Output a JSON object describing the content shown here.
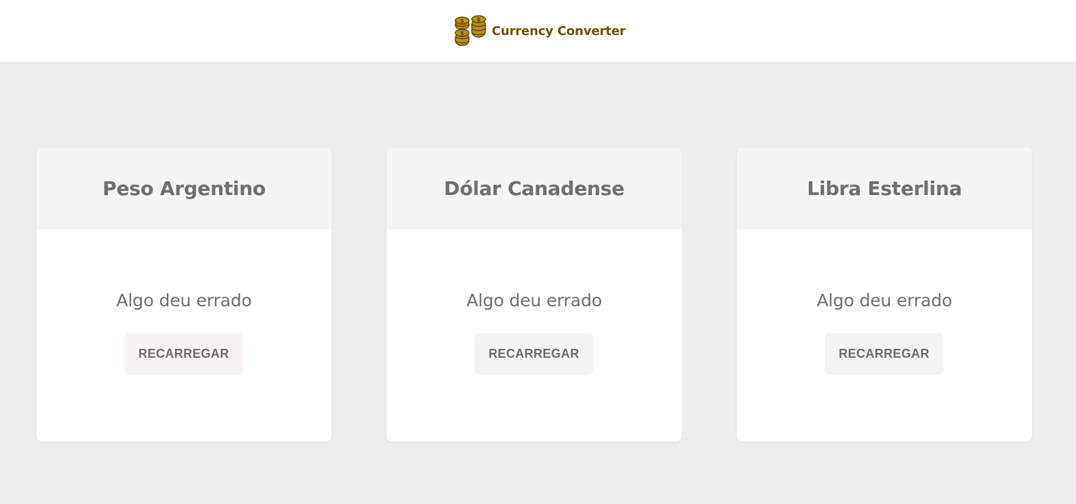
{
  "header": {
    "title": "Currency Converter",
    "logo_icon": "coins-stack-icon",
    "brand_color": "#6b5506"
  },
  "cards": [
    {
      "title": "Peso Argentino",
      "message": "Algo deu errado",
      "button_label": "RECARREGAR"
    },
    {
      "title": "Dólar Canadense",
      "message": "Algo deu errado",
      "button_label": "RECARREGAR"
    },
    {
      "title": "Libra Esterlina",
      "message": "Algo deu errado",
      "button_label": "RECARREGAR"
    }
  ]
}
